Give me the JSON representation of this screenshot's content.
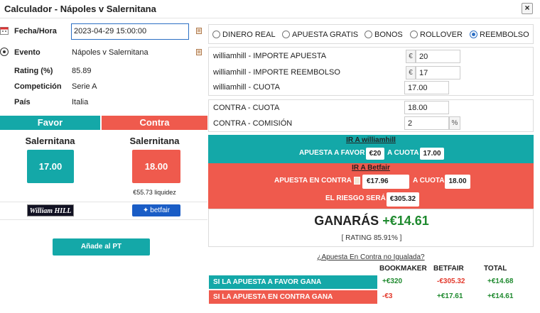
{
  "window": {
    "title": "Calculador - Nápoles v Salernitana",
    "close_label": "×"
  },
  "info": {
    "fecha_label": "Fecha/Hora",
    "fecha_value": "2023-04-29 15:00:00",
    "evento_label": "Evento",
    "evento_value": "Nápoles v Salernitana",
    "rating_label": "Rating (%)",
    "rating_value": "85.89",
    "competicion_label": "Competición",
    "competicion_value": "Serie A",
    "pais_label": "País",
    "pais_value": "Italia"
  },
  "favor": {
    "header": "Favor",
    "team": "Salernitana",
    "odds": "17.00",
    "bookmaker_logo": "William HILL"
  },
  "contra": {
    "header": "Contra",
    "team": "Salernitana",
    "odds": "18.00",
    "liquidity": "€55.73 liquidez",
    "exchange_logo": "betfair"
  },
  "add_button": "Añade al PT",
  "modes": [
    {
      "label": "DINERO REAL",
      "selected": false
    },
    {
      "label": "APUESTA GRATIS",
      "selected": false
    },
    {
      "label": "BONOS",
      "selected": false
    },
    {
      "label": "ROLLOVER",
      "selected": false
    },
    {
      "label": "REEMBOLSO",
      "selected": true
    }
  ],
  "fields": {
    "importe_apuesta_label": "williamhill - IMPORTE APUESTA",
    "importe_apuesta_value": "20",
    "importe_reembolso_label": "williamhill - IMPORTE REEMBOLSO",
    "importe_reembolso_value": "17",
    "cuota_label": "williamhill - CUOTA",
    "cuota_value": "17.00",
    "contra_cuota_label": "CONTRA - CUOTA",
    "contra_cuota_value": "18.00",
    "contra_comision_label": "CONTRA - COMISIÓN",
    "contra_comision_value": "2",
    "currency": "€",
    "percent": "%"
  },
  "result": {
    "ir_favor": "IR A williamhill",
    "apuesta_favor_label": "APUESTA A FAVOR",
    "apuesta_favor_value": "€20",
    "a_cuota_label": "A CUOTA",
    "favor_cuota": "17.00",
    "ir_contra": "IR A Betfair",
    "apuesta_contra_label": "APUESTA EN CONTRA",
    "apuesta_contra_value": "€17.96",
    "contra_cuota": "18.00",
    "riesgo_label": "EL RIESGO SERÁ",
    "riesgo_value": "€305.32",
    "ganaras_label": "GANARÁS",
    "ganaras_value": "+€14.61",
    "rating_text": "[ RATING 85.91% ]",
    "no_igualada": "¿Apuesta En Contra no Igualada?"
  },
  "table": {
    "headers": [
      "BOOKMAKER",
      "BETFAIR",
      "TOTAL"
    ],
    "rows": [
      {
        "label": "SI LA APUESTA A FAVOR GANA",
        "bookmaker": "+€320",
        "betfair": "-€305.32",
        "total": "+€14.68"
      },
      {
        "label": "SI LA APUESTA EN CONTRA GANA",
        "bookmaker": "-€3",
        "betfair": "+€17.61",
        "total": "+€14.61"
      }
    ]
  },
  "colors": {
    "teal": "#14a8a8",
    "red": "#ef5a4d",
    "positive": "#1f8a2f",
    "negative": "#e3392c"
  }
}
